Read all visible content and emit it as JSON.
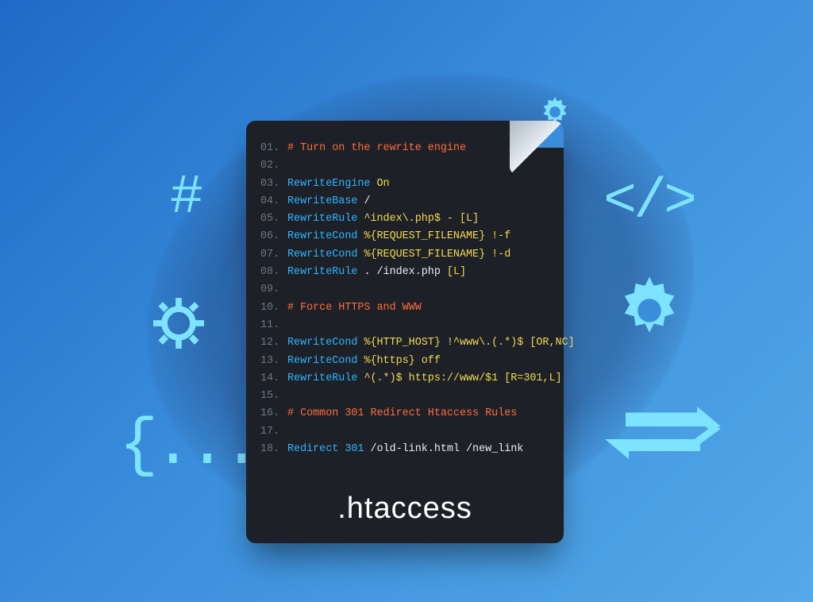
{
  "file_title": ".htaccess",
  "icons": {
    "hash": "#",
    "braces": "{...}",
    "code_brackets": "</>"
  },
  "colors": {
    "comment": "#ff6a3d",
    "keyword": "#2fb4ff",
    "argument": "#f2d94e",
    "plain": "#e9eef4",
    "linenum": "#6d7580",
    "icon": "#7de3ff",
    "file_bg": "#1d2127"
  },
  "lines": [
    {
      "n": "01.",
      "segs": [
        {
          "c": "comment",
          "t": "# Turn on the rewrite engine"
        }
      ]
    },
    {
      "n": "02.",
      "segs": []
    },
    {
      "n": "03.",
      "segs": [
        {
          "c": "key",
          "t": "RewriteEngine "
        },
        {
          "c": "arg",
          "t": "On"
        }
      ]
    },
    {
      "n": "04.",
      "segs": [
        {
          "c": "key",
          "t": "RewriteBase "
        },
        {
          "c": "white",
          "t": "/"
        }
      ]
    },
    {
      "n": "05.",
      "segs": [
        {
          "c": "key",
          "t": "RewriteRule "
        },
        {
          "c": "arg",
          "t": "^index\\.php$ - [L]"
        }
      ]
    },
    {
      "n": "06.",
      "segs": [
        {
          "c": "key",
          "t": "RewriteCond "
        },
        {
          "c": "arg",
          "t": "%{REQUEST_FILENAME} !-f"
        }
      ]
    },
    {
      "n": "07.",
      "segs": [
        {
          "c": "key",
          "t": "RewriteCond "
        },
        {
          "c": "arg",
          "t": "%{REQUEST_FILENAME} !-d"
        }
      ]
    },
    {
      "n": "08.",
      "segs": [
        {
          "c": "key",
          "t": "RewriteRule "
        },
        {
          "c": "white",
          "t": ". /index.php "
        },
        {
          "c": "arg",
          "t": "[L]"
        }
      ]
    },
    {
      "n": "09.",
      "segs": []
    },
    {
      "n": "10.",
      "segs": [
        {
          "c": "comment",
          "t": "# Force HTTPS and WWW"
        }
      ]
    },
    {
      "n": "11.",
      "segs": []
    },
    {
      "n": "12.",
      "segs": [
        {
          "c": "key",
          "t": "RewriteCond "
        },
        {
          "c": "arg",
          "t": "%{HTTP_HOST} !^www\\.(.*)$ [OR,NC]"
        }
      ]
    },
    {
      "n": "13.",
      "segs": [
        {
          "c": "key",
          "t": "RewriteCond "
        },
        {
          "c": "arg",
          "t": "%{https} off"
        }
      ]
    },
    {
      "n": "14.",
      "segs": [
        {
          "c": "key",
          "t": "RewriteRule "
        },
        {
          "c": "arg",
          "t": "^(.*)$ https://www/$1 [R=301,L]"
        }
      ]
    },
    {
      "n": "15.",
      "segs": []
    },
    {
      "n": "16.",
      "segs": [
        {
          "c": "comment",
          "t": "# Common 301 Redirect Htaccess Rules"
        }
      ]
    },
    {
      "n": "17.",
      "segs": []
    },
    {
      "n": "18.",
      "segs": [
        {
          "c": "key",
          "t": "Redirect 301 "
        },
        {
          "c": "white",
          "t": "/old-link.html /new_link"
        }
      ]
    }
  ]
}
